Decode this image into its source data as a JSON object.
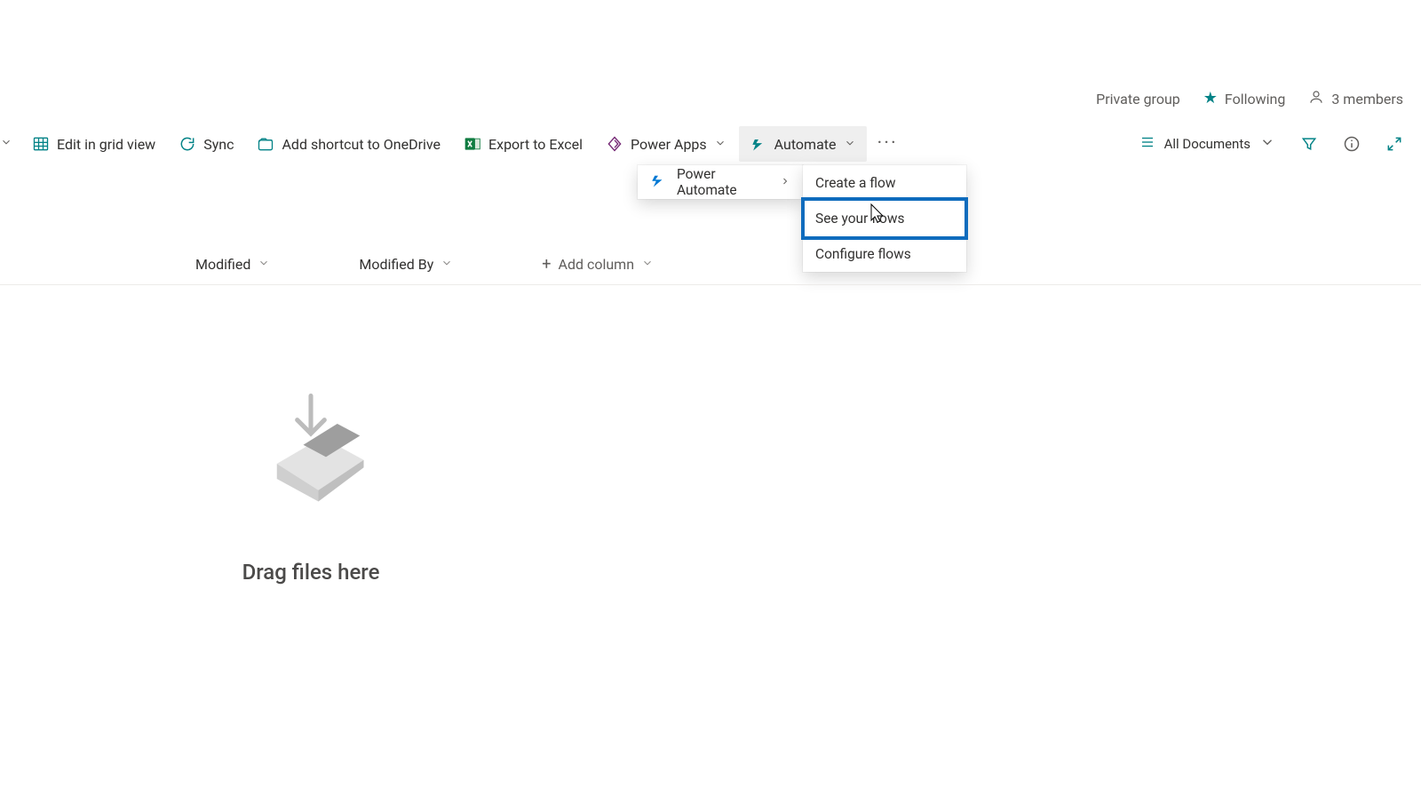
{
  "meta": {
    "privacy": "Private group",
    "following": "Following",
    "members": "3 members"
  },
  "toolbar": {
    "edit_grid": "Edit in grid view",
    "sync": "Sync",
    "add_shortcut": "Add shortcut to OneDrive",
    "export_excel": "Export to Excel",
    "power_apps": "Power Apps",
    "automate": "Automate",
    "view_name": "All Documents"
  },
  "automate_menu": {
    "power_automate": "Power Automate",
    "create_flow": "Create a flow",
    "see_flows": "See your flows",
    "configure_flows": "Configure flows"
  },
  "columns": {
    "modified": "Modified",
    "modified_by": "Modified By",
    "add_column": "Add column"
  },
  "empty_state": {
    "drag_here": "Drag files here"
  }
}
